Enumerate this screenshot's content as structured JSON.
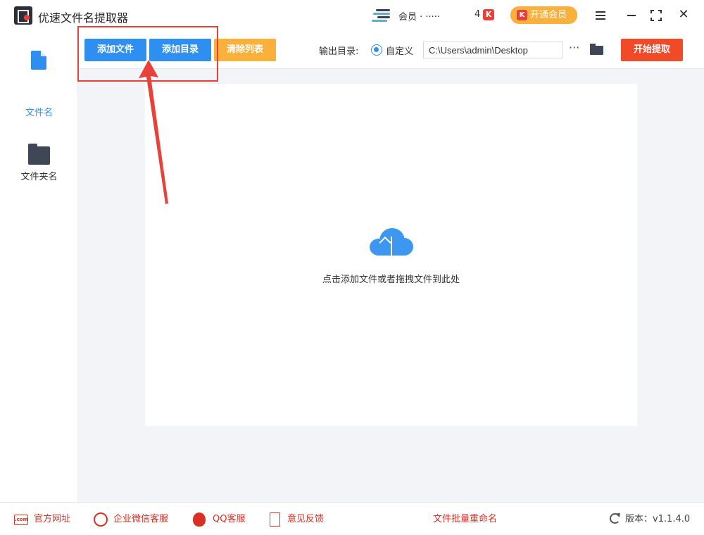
{
  "app": {
    "title": "优速文件名提取器"
  },
  "header": {
    "user_text": "会员 · ·····",
    "user_badge_count": "4",
    "k_icon_label": "K",
    "vip_button": "开通会员",
    "icons": [
      "menu-icon",
      "minimize-icon",
      "maximize-icon",
      "close-icon"
    ]
  },
  "sidebar": {
    "items": [
      {
        "label": "文件名",
        "icon": "file-icon",
        "active": true
      },
      {
        "label": "文件夹名",
        "icon": "folder-icon",
        "active": false
      }
    ]
  },
  "toolbar": {
    "add_file": "添加文件",
    "add_dir": "添加目录",
    "clear_list": "清除列表",
    "output_label": "输出目录:",
    "radio_label": "自定义",
    "output_path": "C:\\Users\\admin\\Desktop",
    "more": "···",
    "start": "开始提取"
  },
  "dropzone": {
    "hint": "点击添加文件或者拖拽文件到此处"
  },
  "footer": {
    "links": [
      {
        "label": "官方网址",
        "icon": "website-icon",
        "icon_text": ".com"
      },
      {
        "label": "企业微信客服",
        "icon": "wecom-icon"
      },
      {
        "label": "QQ客服",
        "icon": "qq-icon"
      },
      {
        "label": "意见反馈",
        "icon": "feedback-icon"
      }
    ],
    "center_link": "文件批量重命名",
    "version": "版本：v1.1.4.0"
  },
  "colors": {
    "primary": "#2f8ff0",
    "warning": "#fbb03b",
    "danger": "#f04a28",
    "annotation": "#e8413a",
    "footer_link": "#d93025"
  }
}
